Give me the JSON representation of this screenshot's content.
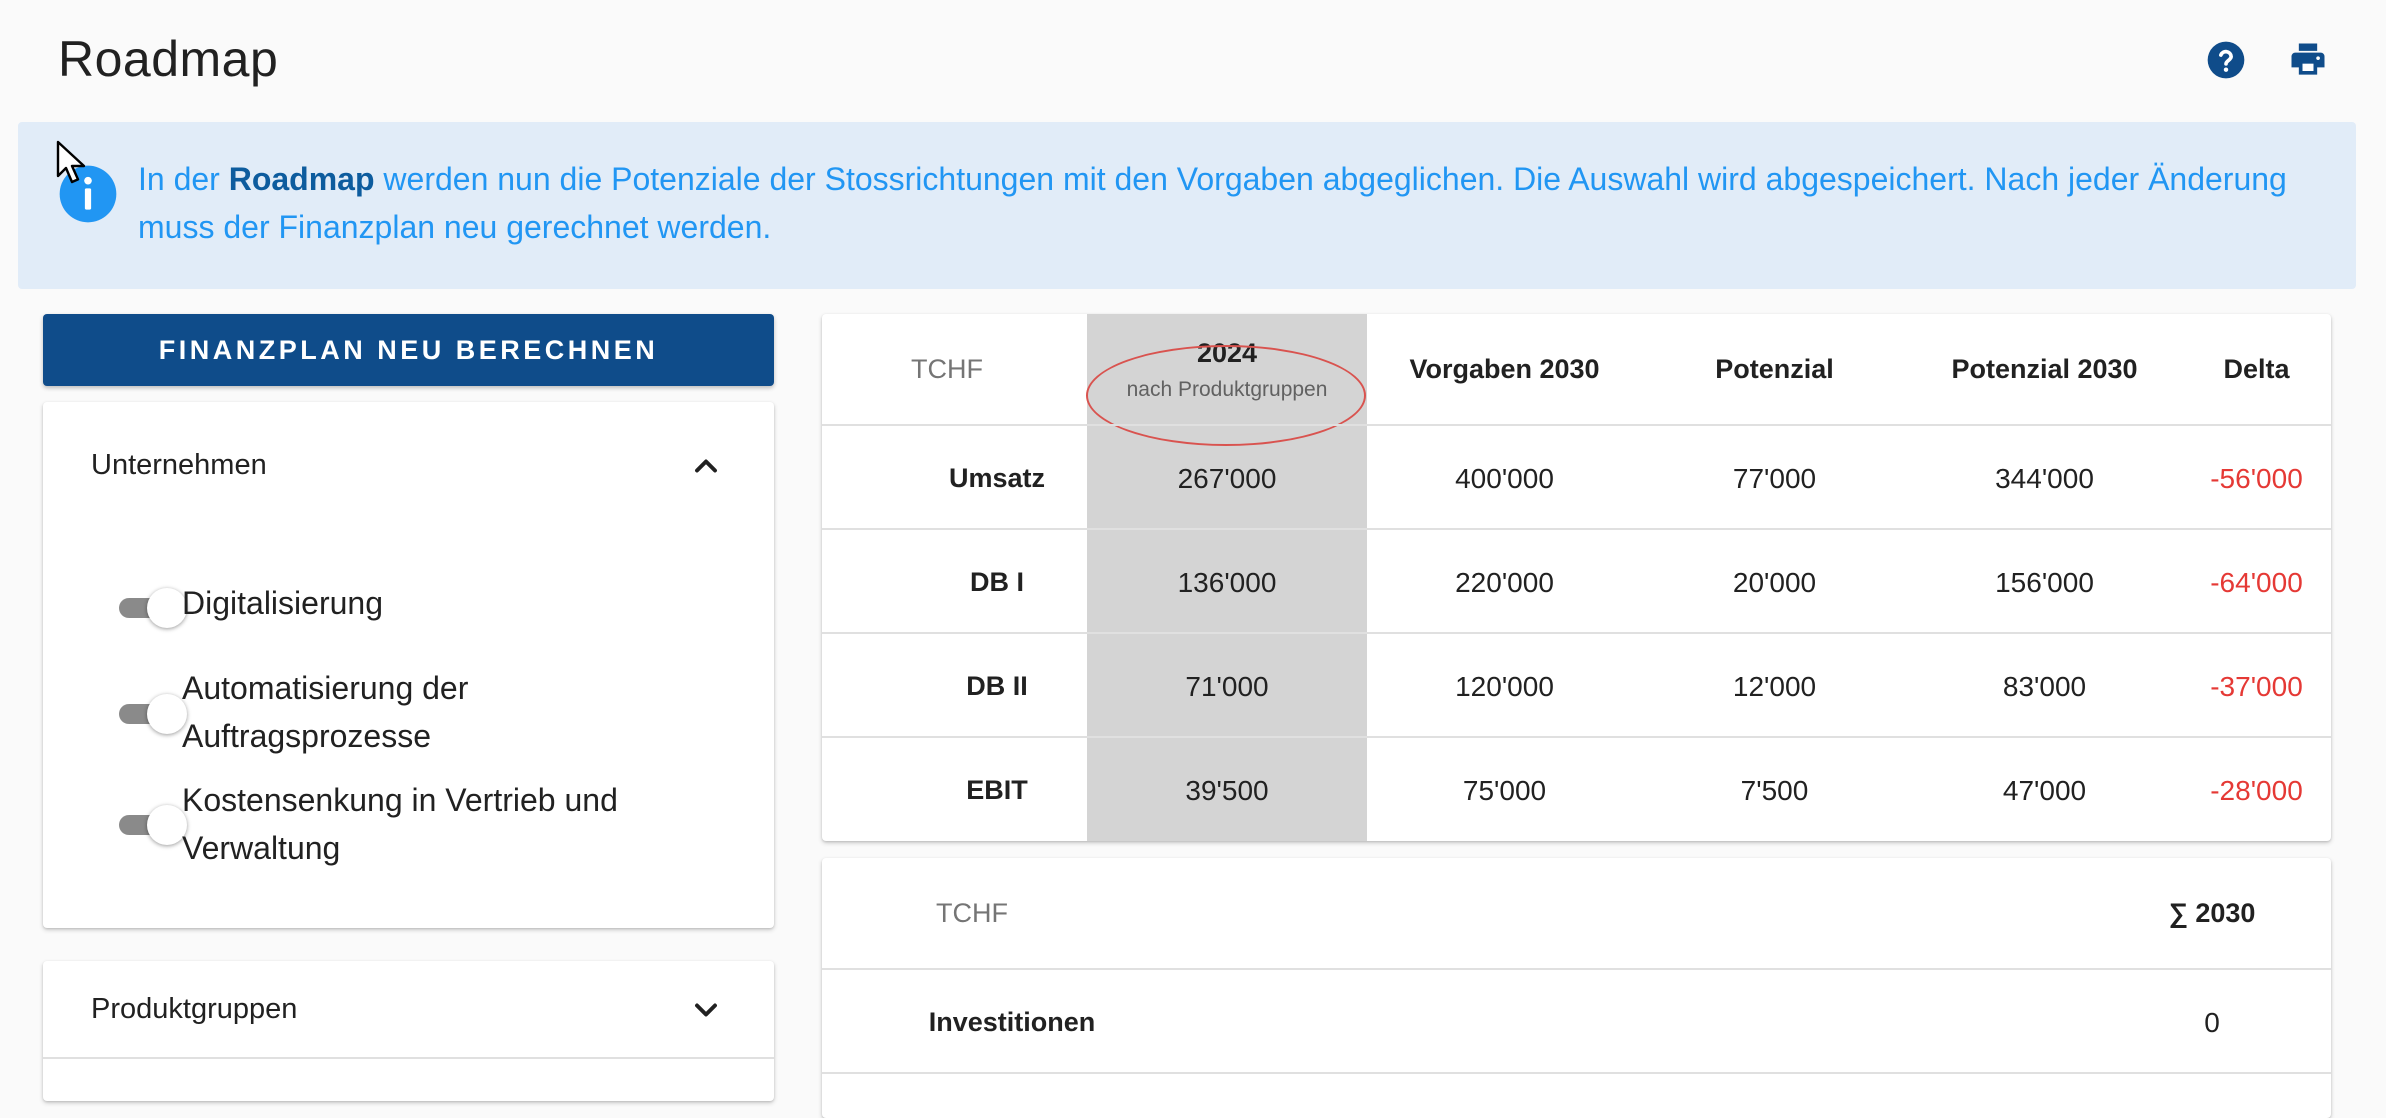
{
  "page": {
    "title": "Roadmap"
  },
  "toolbar": {
    "help_icon": "help-circle-icon",
    "print_icon": "printer-icon"
  },
  "info": {
    "icon": "info-icon",
    "text_before": "In der ",
    "text_bold": "Roadmap",
    "text_after": " werden nun die Potenziale der Stossrichtungen mit den Vorgaben abgeglichen. Die Auswahl wird abgespeichert. Nach jeder Änderung muss der Finanzplan neu gerechnet werden."
  },
  "actions": {
    "recalc_label": "FINANZPLAN NEU BERECHNEN"
  },
  "panels": {
    "unternehmen": {
      "title": "Unternehmen",
      "expanded": true,
      "toggles": [
        {
          "label": "Digitalisierung",
          "on": true
        },
        {
          "label": "Automatisierung der Auftragsprozesse",
          "on": true
        },
        {
          "label": "Kostensenkung in Vertrieb und Verwaltung",
          "on": true
        }
      ]
    },
    "produktgruppen": {
      "title": "Produktgruppen",
      "expanded": false
    }
  },
  "kpi_table": {
    "unit": "TCHF",
    "year_header": "2024",
    "year_sub": "nach Produktgruppen",
    "headers": [
      "Vorgaben 2030",
      "Potenzial",
      "Potenzial 2030",
      "Delta"
    ],
    "rows": [
      {
        "label": "Umsatz",
        "y2024": "267'000",
        "vorgaben": "400'000",
        "potenzial": "77'000",
        "potenzial2030": "344'000",
        "delta": "-56'000"
      },
      {
        "label": "DB I",
        "y2024": "136'000",
        "vorgaben": "220'000",
        "potenzial": "20'000",
        "potenzial2030": "156'000",
        "delta": "-64'000"
      },
      {
        "label": "DB II",
        "y2024": "71'000",
        "vorgaben": "120'000",
        "potenzial": "12'000",
        "potenzial2030": "83'000",
        "delta": "-37'000"
      },
      {
        "label": "EBIT",
        "y2024": "39'500",
        "vorgaben": "75'000",
        "potenzial": "7'500",
        "potenzial2030": "47'000",
        "delta": "-28'000"
      }
    ],
    "colors": {
      "negative": "#e53935",
      "highlight_column": "#d4d4d4"
    }
  },
  "invest_table": {
    "unit": "TCHF",
    "sum_header": "∑ 2030",
    "rows": [
      {
        "label": "Investitionen",
        "value": "0"
      }
    ]
  },
  "colors": {
    "primary": "#0f4c8a",
    "info_bg": "#e1ecf8",
    "info_text": "#2196f3"
  }
}
